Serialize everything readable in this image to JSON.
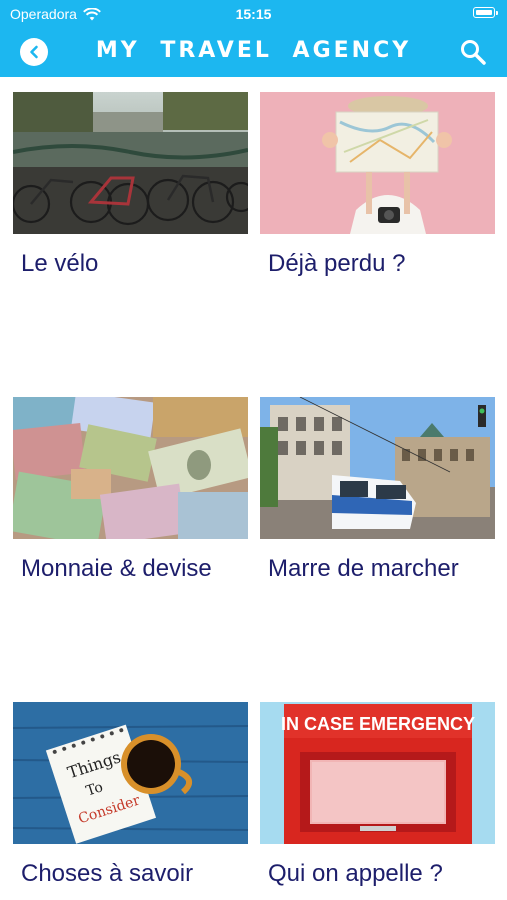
{
  "status_bar": {
    "carrier": "Operadora",
    "time": "15:15"
  },
  "header": {
    "title": "MY TRAVEL AGENCY"
  },
  "icons": {
    "back": "chevron-left-icon",
    "search": "search-icon",
    "wifi": "wifi-icon",
    "battery": "battery-icon"
  },
  "colors": {
    "header_bg": "#1cb7f0",
    "label_text": "#1d1e6b"
  },
  "cards": [
    {
      "label": "Le vélo"
    },
    {
      "label": "Déjà perdu ?"
    },
    {
      "label": "Monnaie & devise"
    },
    {
      "label": "Marre de marcher"
    },
    {
      "label": "Choses à savoir"
    },
    {
      "label": "Qui on appelle ?"
    }
  ],
  "images": {
    "note_lines": [
      "Things",
      "To",
      "Consider"
    ],
    "emergency_sign": "IN CASE EMERGENCY"
  }
}
